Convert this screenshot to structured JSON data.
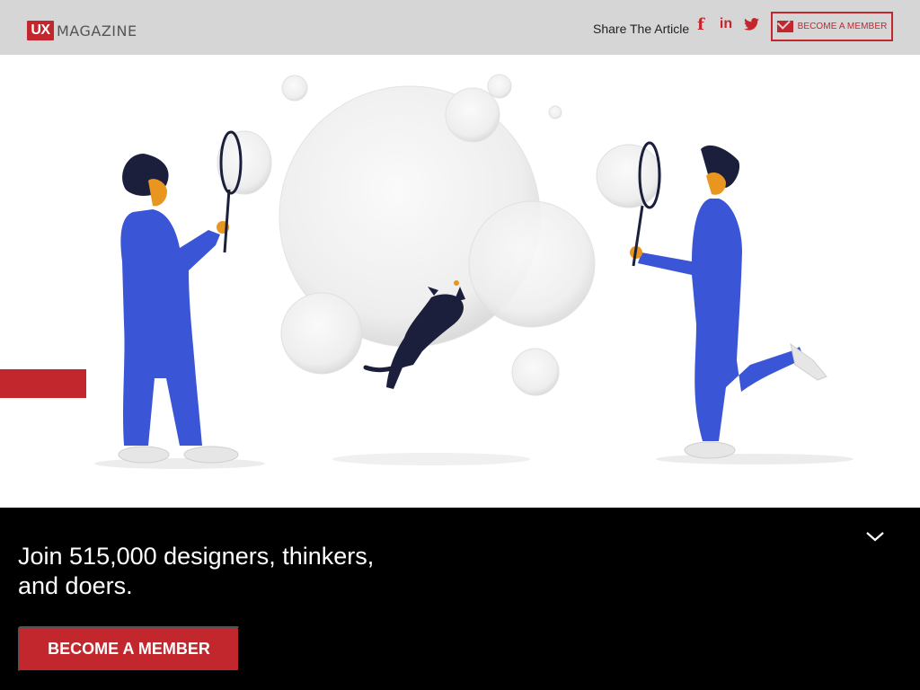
{
  "header": {
    "logo_mark": "UX",
    "logo_text": "MAGAZINE",
    "share_label": "Share The Article",
    "social": [
      "facebook-icon",
      "linkedin-icon",
      "twitter-icon"
    ],
    "become_member_label": "BECOME A MEMBER"
  },
  "overlay": {
    "headline_line1": "Join 515,000 designers, thinkers,",
    "headline_line2": "and doers.",
    "cta_label": "BECOME A MEMBER"
  },
  "colors": {
    "brand_red": "#c1272d",
    "header_bg": "#d6d6d6",
    "overlay_bg": "#000000",
    "figure_blue": "#3a56d6"
  }
}
